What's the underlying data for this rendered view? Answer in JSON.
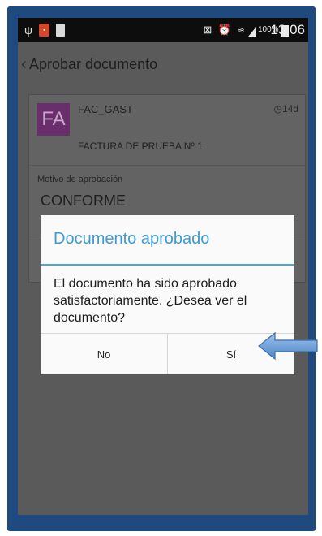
{
  "status_bar": {
    "battery_percent": "100%",
    "time": "13:06",
    "icons": [
      "usb-icon",
      "notification-app-icon",
      "battery-small-icon",
      "mute-icon",
      "alarm-icon",
      "wifi-icon",
      "signal-icon",
      "battery-icon"
    ]
  },
  "action_bar": {
    "back_glyph": "‹",
    "title": "Aprobar documento"
  },
  "card": {
    "avatar": "FA",
    "code": "FAC_GAST",
    "age": "14d",
    "description": "FACTURA DE PRUEBA Nº 1",
    "motivo_label": "Motivo de aprobación",
    "motivo_value": "CONFORME"
  },
  "dialog": {
    "title": "Documento aprobado",
    "message": "El documento ha sido aprobado satisfactoriamente. ¿Desea ver el documento?",
    "no_label": "No",
    "yes_label": "Sí"
  },
  "colors": {
    "frame": "#1f4a80",
    "dialog_title": "#3d9ad3",
    "arrow": "#6aa0dc",
    "avatar": "#6a2e6d"
  }
}
